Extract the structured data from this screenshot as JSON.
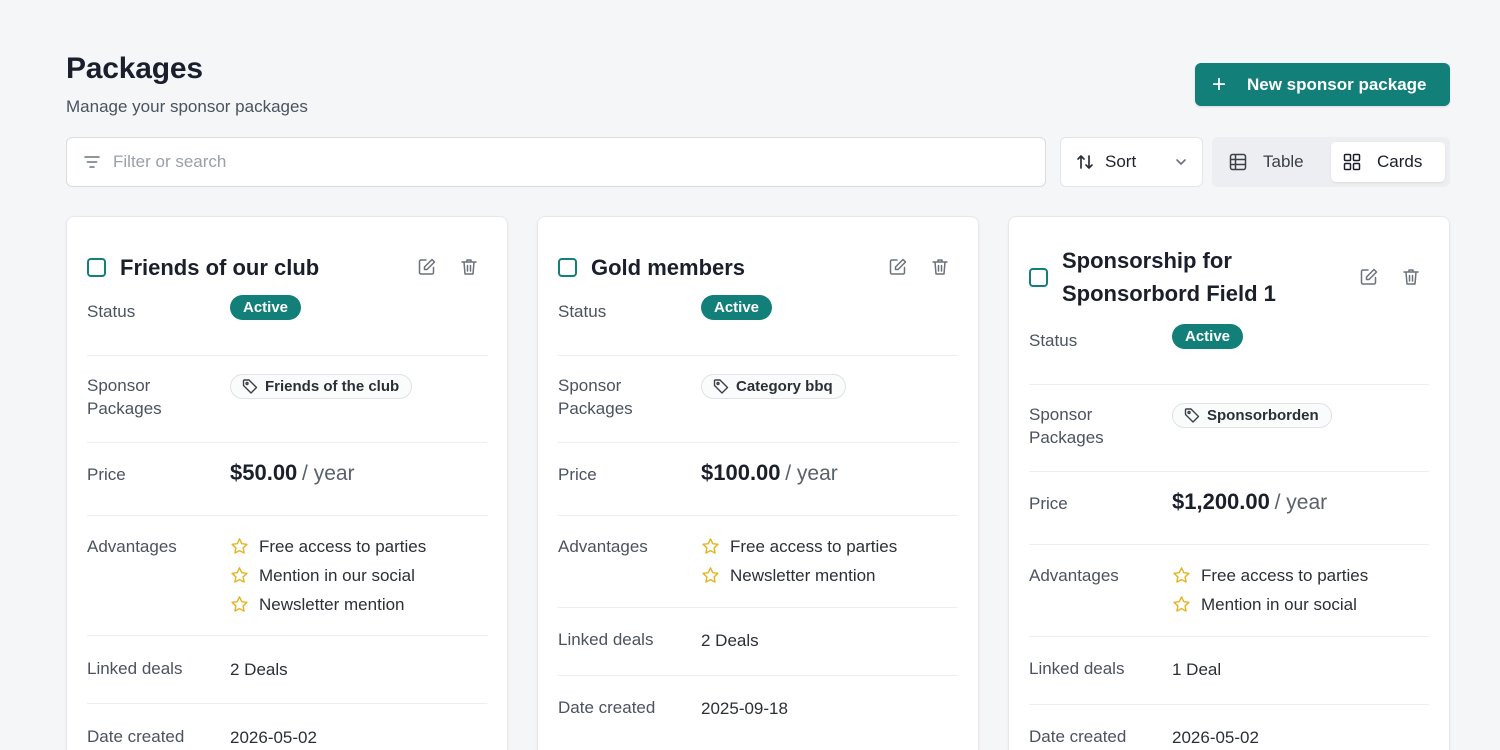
{
  "header": {
    "title": "Packages",
    "subtitle": "Manage your sponsor packages",
    "new_button_label": "New sponsor package"
  },
  "toolbar": {
    "search_placeholder": "Filter or search",
    "sort_label": "Sort",
    "view_table_label": "Table",
    "view_cards_label": "Cards",
    "active_view": "Cards"
  },
  "labels": {
    "status": "Status",
    "sponsor_packages_line1": "Sponsor",
    "sponsor_packages_line2": "Packages",
    "price": "Price",
    "advantages": "Advantages",
    "linked_deals": "Linked deals",
    "date_created": "Date created"
  },
  "colors": {
    "accent": "#127f78",
    "star": "#e6b323"
  },
  "cards": [
    {
      "title": "Friends of our club",
      "status": "Active",
      "tag": "Friends of the club",
      "price": "$50.00",
      "period": "/ year",
      "advantages": [
        "Free access to parties",
        "Mention in our social",
        "Newsletter mention"
      ],
      "linked_deals": "2 Deals",
      "date_created": "2026-05-02"
    },
    {
      "title": "Gold members",
      "status": "Active",
      "tag": "Category bbq",
      "price": "$100.00",
      "period": "/ year",
      "advantages": [
        "Free access to parties",
        "Newsletter mention"
      ],
      "linked_deals": "2 Deals",
      "date_created": "2025-09-18"
    },
    {
      "title": "Sponsorship for Sponsorbord Field 1",
      "status": "Active",
      "tag": "Sponsorborden",
      "price": "$1,200.00",
      "period": "/ year",
      "advantages": [
        "Free access to parties",
        "Mention in our social"
      ],
      "linked_deals": "1 Deal",
      "date_created": "2026-05-02"
    }
  ]
}
